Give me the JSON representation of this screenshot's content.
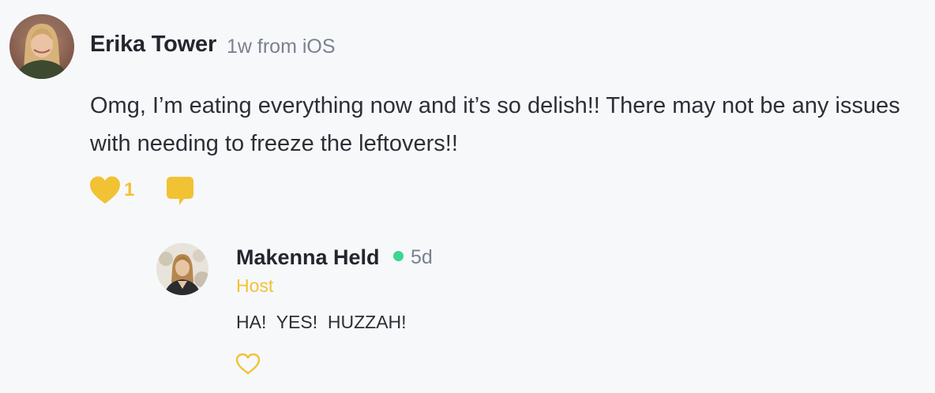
{
  "colors": {
    "accent": "#f2c235",
    "online": "#3dd68c",
    "background": "#f7f8fa"
  },
  "post": {
    "author": "Erika Tower",
    "meta": "1w from iOS",
    "text": "Omg, I’m eating everything now and it’s so delish!! There may not be any issues with needing to freeze the leftovers!!",
    "like_count": "1",
    "liked": true,
    "icons": {
      "like": "heart-filled-icon",
      "comment": "comment-bubble-icon"
    }
  },
  "reply": {
    "author": "Makenna Held",
    "online": true,
    "time": "5d",
    "role": "Host",
    "text": "HA!  YES!  HUZZAH!",
    "liked": false,
    "icons": {
      "like": "heart-outline-icon"
    }
  }
}
